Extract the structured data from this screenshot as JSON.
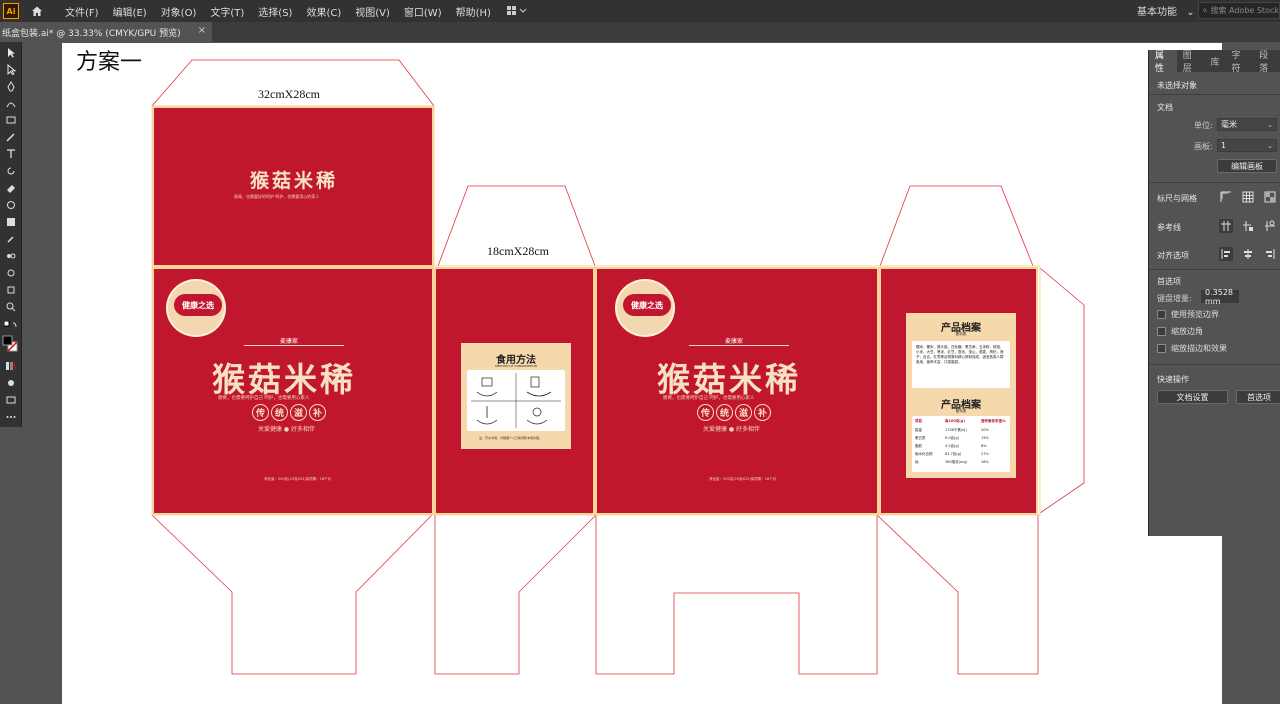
{
  "app": {
    "logo": "Ai"
  },
  "menu": [
    "文件(F)",
    "编辑(E)",
    "对象(O)",
    "文字(T)",
    "选择(S)",
    "效果(C)",
    "视图(V)",
    "窗口(W)",
    "帮助(H)"
  ],
  "workspace": {
    "label": "基本功能",
    "chevron": "⌄"
  },
  "search": {
    "placeholder": "搜索 Adobe Stock"
  },
  "tab": {
    "title": "纸盒包装.ai* @ 33.33% (CMYK/GPU 预览)",
    "close": "×"
  },
  "artboard": {
    "title": "方案一"
  },
  "dimensions": {
    "large": "32cmX28cm",
    "small": "18cmX28cm"
  },
  "packaging": {
    "brand_name": "猴菇米稀",
    "slogan_top": "肠胃，也需要好的呵护   呵护，也需要用心的家人",
    "slogan_main": "肠胃，也需要呵护自己     呵护，也需要用心家人",
    "badge_text": "健康之选",
    "logo_text": "麦康家",
    "round_chars": [
      "传",
      "统",
      "滋",
      "补"
    ],
    "tagline": "关爱健康 ● 好多相伴",
    "footer": "净含量：500克(20克X25)保质期：18个月",
    "usage_title": "食用方法",
    "usage_subtitle": "METHOD OF CONSUMPTION",
    "usage_note": "注：开水冲调，可根据个人口味调整冲调水量。",
    "archive_title": "产品档案",
    "archive_sub": "配料表",
    "ingredients_text": "糯米，粳米，猴头菇，白砂糖，黑芝麻，玉米粉，核桃，小米，大豆，黑米，红豆，薏米，淮山，燕麦，枸杞，莲子，百合，红枣等谷物原料精心研制而成，适宜各类人群食用，营养丰富，口感香甜。",
    "nutrition_header": [
      "项目",
      "每100克(g)",
      "营养素参考值%"
    ],
    "nutrition_rows": [
      [
        "能量",
        "1708千焦(kJ)",
        "20%"
      ],
      [
        "蛋白质",
        "9.0克(g)",
        "15%"
      ],
      [
        "脂肪",
        "4.5克(g)",
        "8%"
      ],
      [
        "碳水化合物",
        "81.7克(g)",
        "27%"
      ],
      [
        "钠",
        "360毫克(mg)",
        "18%"
      ]
    ]
  },
  "panel": {
    "tabs": [
      "属性",
      "图层",
      "库",
      "字符",
      "段落"
    ],
    "no_selection": "未选择对象",
    "document_label": "文档",
    "unit_label": "单位:",
    "unit_value": "毫米",
    "artboard_label": "画板:",
    "artboard_value": "1",
    "edit_artboard": "编辑画板",
    "rulers_grids": "标尺与网格",
    "guides": "参考线",
    "align": "对齐选项",
    "preferences": "首选项",
    "keyboard_increment_label": "键盘增量:",
    "keyboard_increment_value": "0.3528 mm",
    "checkboxes": [
      "使用预览边界",
      "缩放边角",
      "缩放描边和效果"
    ],
    "quick_actions": "快速操作",
    "doc_settings": "文档设置",
    "prefs_button": "首选项"
  }
}
